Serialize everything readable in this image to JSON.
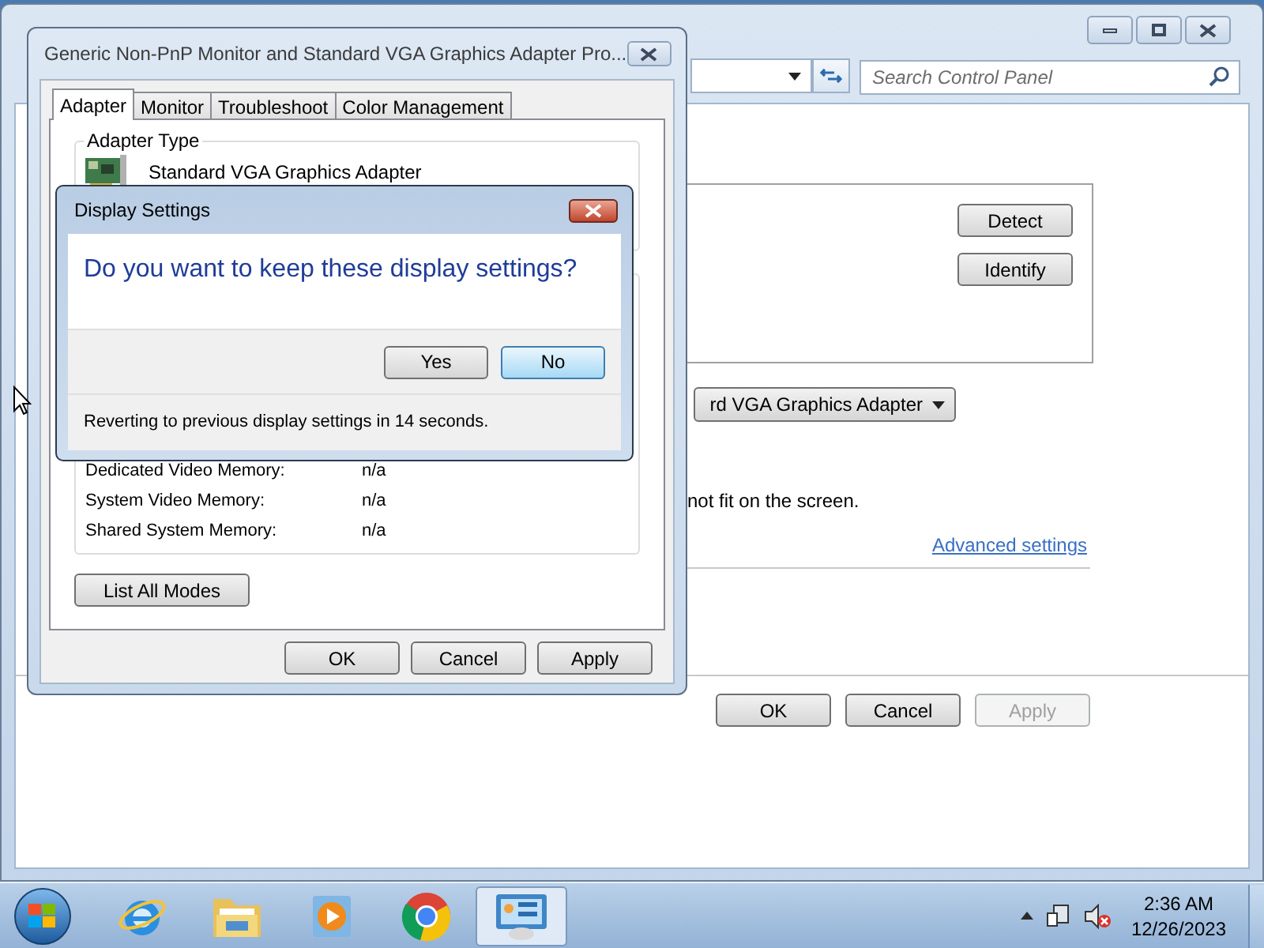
{
  "control_panel": {
    "search": {
      "placeholder": "Search Control Panel"
    },
    "side_buttons": [
      {
        "label": "Detect"
      },
      {
        "label": "Identify"
      }
    ],
    "adapter_dropdown": {
      "value": "rd VGA Graphics Adapter"
    },
    "note": "not fit on the screen.",
    "link": "Advanced settings",
    "buttons": [
      {
        "label": "OK",
        "disabled": false
      },
      {
        "label": "Cancel",
        "disabled": false
      },
      {
        "label": "Apply",
        "disabled": true
      }
    ]
  },
  "properties_window": {
    "title": "Generic Non-PnP Monitor and Standard VGA Graphics Adapter Pro...",
    "tabs": [
      {
        "label": "Adapter",
        "selected": true
      },
      {
        "label": "Monitor",
        "selected": false
      },
      {
        "label": "Troubleshoot",
        "selected": false
      },
      {
        "label": "Color Management",
        "selected": false
      }
    ],
    "adapter_type": {
      "heading": "Adapter Type",
      "name": "Standard VGA Graphics Adapter"
    },
    "memory": [
      {
        "label": "Dedicated Video Memory:",
        "value": "n/a"
      },
      {
        "label": "System Video Memory:",
        "value": "n/a"
      },
      {
        "label": "Shared System Memory:",
        "value": "n/a"
      }
    ],
    "list_button": "List All Modes",
    "buttons": [
      {
        "label": "OK",
        "disabled": false
      },
      {
        "label": "Cancel",
        "disabled": false
      },
      {
        "label": "Apply",
        "disabled": false
      }
    ]
  },
  "dialog": {
    "title": "Display Settings",
    "question": "Do you want to keep these display settings?",
    "buttons": [
      {
        "label": "Yes",
        "default": false
      },
      {
        "label": "No",
        "default": true
      }
    ],
    "status": "Reverting to previous display settings in 14 seconds."
  },
  "taskbar": {
    "apps": [
      {
        "kind": "browser",
        "active": false
      },
      {
        "kind": "folder",
        "active": false
      },
      {
        "kind": "media",
        "active": false
      },
      {
        "kind": "globe",
        "active": false
      },
      {
        "kind": "control-panel",
        "active": true
      }
    ],
    "time": "2:36 AM",
    "date": "12/26/2023"
  }
}
